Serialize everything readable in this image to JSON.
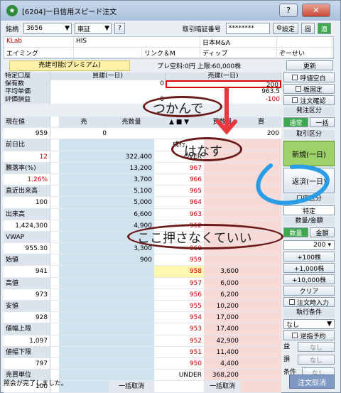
{
  "window": {
    "title": "[6204]一日信用スピード注文",
    "help": "?",
    "close": "✕"
  },
  "top": {
    "symbol_label": "銘柄",
    "symbol_value": "3656",
    "market": "東証",
    "market_q": "?",
    "pin_label": "取引暗証番号",
    "pin_value": "********",
    "settings": "設定",
    "fixed": "固",
    "link": "連"
  },
  "info": {
    "rows": [
      [
        "KLab",
        "HIS",
        "日本M&A",
        ""
      ],
      [
        "エイミング",
        "",
        "リンク＆M",
        "ディップ",
        "ぞーせい"
      ]
    ]
  },
  "status_bar": {
    "yellow": "売建可能(プレミアム)",
    "premium": "プレ空料:0円  上限:60,000株",
    "refresh": "更新"
  },
  "positions": {
    "account": "特定口座",
    "buy_hdr": "買建(一日)",
    "sell_hdr": "売建(一日)",
    "rows": [
      {
        "label": "保有数",
        "buy": "0",
        "sell": "200"
      },
      {
        "label": "平均単価",
        "buy": "",
        "sell": "963.5"
      },
      {
        "label": "評価損益",
        "buy": "0",
        "sell": "-100"
      }
    ]
  },
  "side": {
    "cb1": "呼値空白",
    "cb2": "板固定",
    "cb3": "注文確認",
    "issue_section": "発注区分",
    "mode_normal": "通常",
    "mode_bulk": "一括",
    "trade_section": "取引区分",
    "new_order": "新規(一日)",
    "repay": "返済(一日)",
    "account_section": "口座区分",
    "account_value": "特定",
    "qty_section": "数量/金額",
    "qty_tab": "数量",
    "amount_tab": "金額",
    "qty_value": "200",
    "qtybtns": [
      "+100株",
      "+1,000株",
      "+10,000株",
      "クリア"
    ],
    "cb4": "注文時入力",
    "exec_section": "執行条件",
    "exec_value": "なし",
    "cb5": "逆指予約",
    "profit_label": "益",
    "profit_value": "なし",
    "loss_label": "損",
    "loss_value": "なし",
    "cond_label": "条件",
    "cond_value": "なし",
    "cancel_order": "注文取消"
  },
  "board": {
    "hdr": {
      "sell": "売",
      "sell_qty": "売数量",
      "buy_qty": "買数量",
      "buy": "買"
    },
    "input_row": {
      "left": "959",
      "sell": "0",
      "buy": "200"
    },
    "rows": [
      {
        "label": "前日比",
        "val": "",
        "sell_qty": "",
        "price": "成行",
        "buy_qty": ""
      },
      {
        "label": "",
        "val": "12",
        "sell_qty": "322,400",
        "price": "OVER",
        "buy_qty": ""
      },
      {
        "label": "騰落率(%)",
        "val": "",
        "sell_qty": "13,200",
        "price": "967",
        "buy_qty": ""
      },
      {
        "label": "",
        "val": "1.26%",
        "sell_qty": "3,700",
        "price": "966",
        "buy_qty": ""
      },
      {
        "label": "直近出来高",
        "val": "",
        "sell_qty": "5,100",
        "price": "965",
        "buy_qty": ""
      },
      {
        "label": "",
        "val": "100",
        "sell_qty": "5,000",
        "price": "964",
        "buy_qty": ""
      },
      {
        "label": "出来高",
        "val": "",
        "sell_qty": "6,600",
        "price": "963",
        "buy_qty": ""
      },
      {
        "label": "",
        "val": "1,424,300",
        "sell_qty": "4,900",
        "price": "962",
        "buy_qty": ""
      },
      {
        "label": "VWAP",
        "val": "",
        "sell_qty": "",
        "price": "",
        "buy_qty": ""
      },
      {
        "label": "",
        "val": "955.30",
        "sell_qty": "3,300",
        "price": "960",
        "buy_qty": ""
      },
      {
        "label": "始値",
        "val": "",
        "sell_qty": "900",
        "price": "959",
        "buy_qty": ""
      },
      {
        "label": "",
        "val": "941",
        "sell_qty": "",
        "price": "958",
        "buy_qty": "3,600"
      },
      {
        "label": "高値",
        "val": "",
        "sell_qty": "",
        "price": "957",
        "buy_qty": "6,000"
      },
      {
        "label": "",
        "val": "973",
        "sell_qty": "",
        "price": "956",
        "buy_qty": "6,200"
      },
      {
        "label": "安値",
        "val": "",
        "sell_qty": "",
        "price": "955",
        "buy_qty": "10,200"
      },
      {
        "label": "",
        "val": "928",
        "sell_qty": "",
        "price": "954",
        "buy_qty": "17,000"
      },
      {
        "label": "値幅上限",
        "val": "",
        "sell_qty": "",
        "price": "953",
        "buy_qty": "17,400"
      },
      {
        "label": "",
        "val": "1,097",
        "sell_qty": "",
        "price": "952",
        "buy_qty": "42,900"
      },
      {
        "label": "値幅下限",
        "val": "",
        "sell_qty": "",
        "price": "951",
        "buy_qty": "11,400"
      },
      {
        "label": "",
        "val": "797",
        "sell_qty": "",
        "price": "950",
        "buy_qty": "4,400"
      },
      {
        "label": "売買単位",
        "val": "",
        "sell_qty": "",
        "price": "UNDER",
        "buy_qty": "368,200"
      },
      {
        "label": "",
        "val": "100",
        "sell_qty": "一括取消",
        "price": "",
        "buy_qty": "一括取消"
      }
    ],
    "price_label": "現在値"
  },
  "footer": {
    "status": "照会が完了しました。"
  },
  "annotations": {
    "grab": "つかんで",
    "release": "はなす",
    "nopress": "ここ押さなくていい"
  }
}
